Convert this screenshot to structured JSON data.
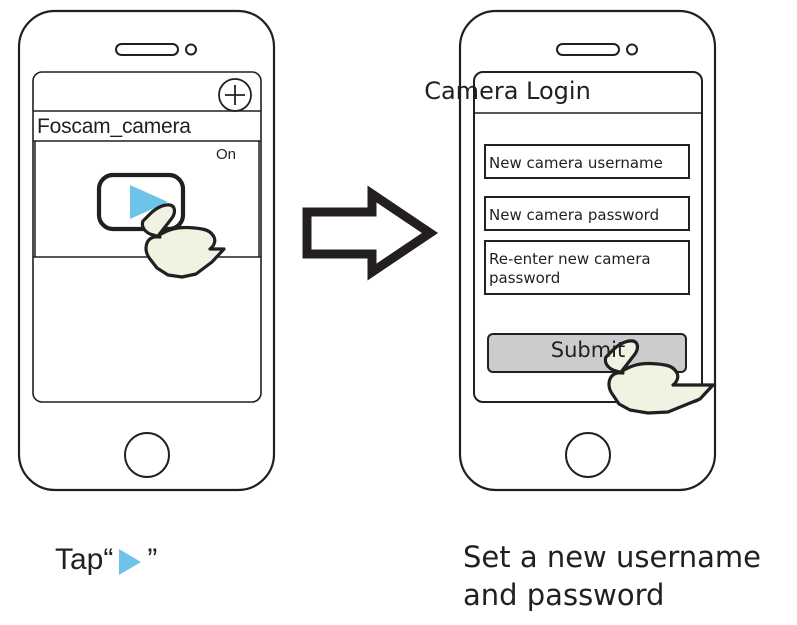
{
  "figure": {
    "type": "instructional-step-diagram",
    "step_count": 2
  },
  "colors": {
    "outline": "#231f20",
    "play_triangle": "#6EC4E8",
    "hand_fill": "#F1F3E2",
    "submit_button": "#CCCCCC",
    "background": "#FFFFFF"
  },
  "left_phone": {
    "name": "camera-list-screen",
    "toolbar": {
      "add_icon": "plus-circle-icon"
    },
    "list": {
      "items": [
        {
          "device_name": "Foscam_camera",
          "status": "On",
          "action_icon": "play-icon"
        }
      ]
    },
    "hardware": {
      "speaker": "speaker-slot",
      "front_camera": "front-camera-lens",
      "home_button": "home-button"
    }
  },
  "right_phone": {
    "name": "camera-login-screen",
    "header": {
      "title": "Camera Login"
    },
    "fields": [
      {
        "label": "New camera username"
      },
      {
        "label": "New camera password"
      },
      {
        "label": "Re-enter new camera password"
      }
    ],
    "submit": {
      "label": "Submit"
    },
    "hardware": {
      "speaker": "speaker-slot",
      "front_camera": "front-camera-lens",
      "home_button": "home-button"
    }
  },
  "flow_arrow": {
    "icon": "right-arrow-icon",
    "direction": "right"
  },
  "pointers": {
    "left": "hand-tap-cursor",
    "right": "hand-tap-cursor"
  },
  "captions": {
    "left": {
      "prefix": "Tap ",
      "open_quote": "“",
      "symbol_icon": "play-icon",
      "close_quote": "”"
    },
    "right": {
      "line1": "Set a new username",
      "line2": "and password"
    }
  }
}
